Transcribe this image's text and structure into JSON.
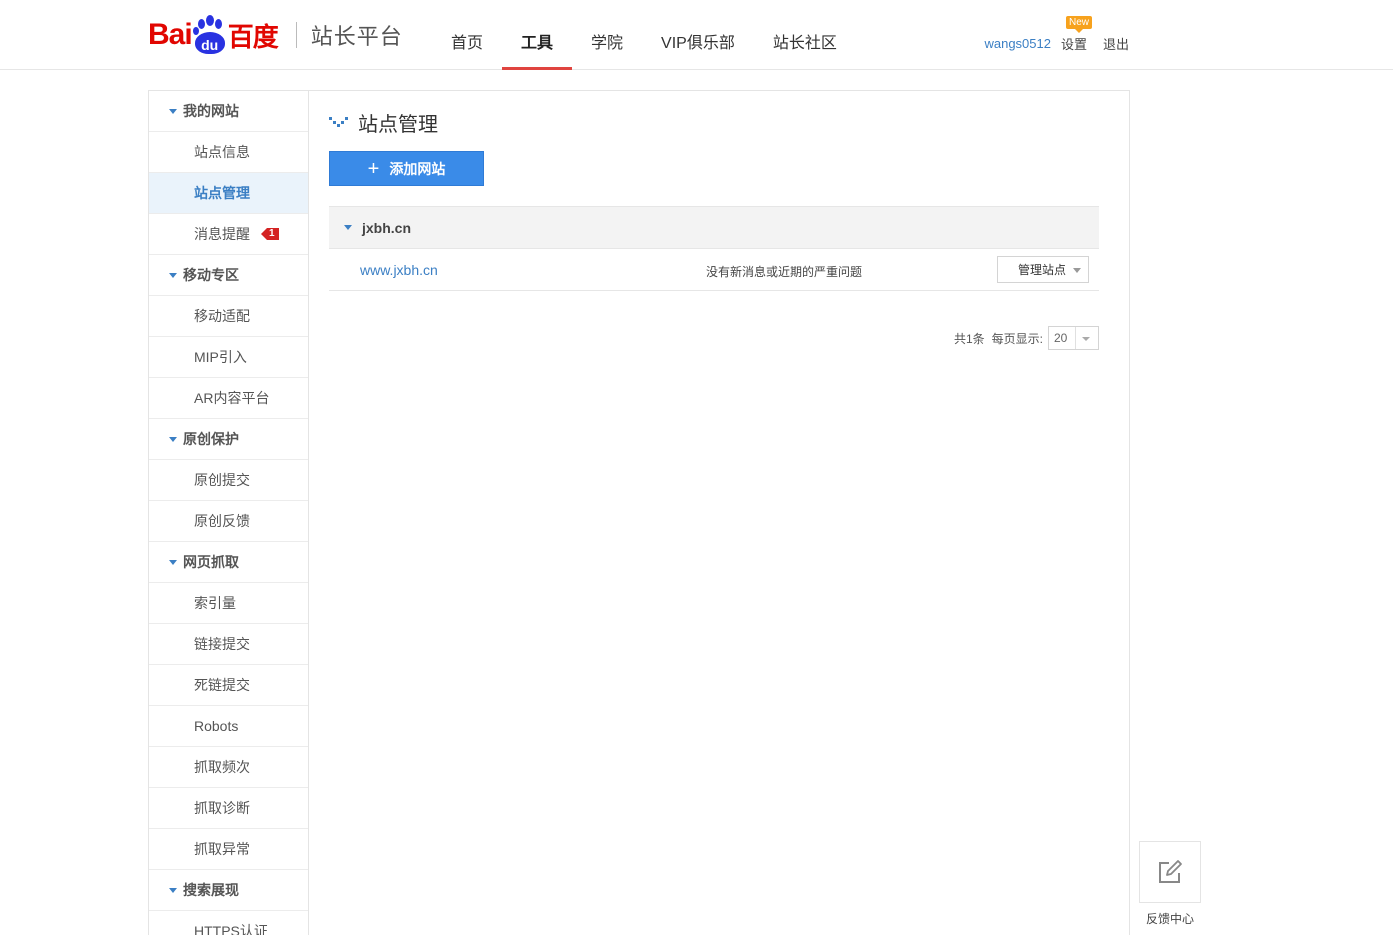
{
  "header": {
    "logo": {
      "bai": "Bai",
      "du": "du",
      "cn": "百度",
      "subtitle": "站长平台"
    },
    "nav": [
      {
        "label": "首页",
        "active": false
      },
      {
        "label": "工具",
        "active": true
      },
      {
        "label": "学院",
        "active": false
      },
      {
        "label": "VIP俱乐部",
        "active": false
      },
      {
        "label": "站长社区",
        "active": false
      }
    ],
    "user": {
      "username": "wangs0512",
      "settings": "设置",
      "new_badge": "New",
      "logout": "退出"
    }
  },
  "sidebar": {
    "groups": [
      {
        "label": "我的网站",
        "items": [
          "站点信息",
          "站点管理",
          "消息提醒"
        ]
      },
      {
        "label": "移动专区",
        "items": [
          "移动适配",
          "MIP引入",
          "AR内容平台"
        ]
      },
      {
        "label": "原创保护",
        "items": [
          "原创提交",
          "原创反馈"
        ]
      },
      {
        "label": "网页抓取",
        "items": [
          "索引量",
          "链接提交",
          "死链提交",
          "Robots",
          "抓取频次",
          "抓取诊断",
          "抓取异常"
        ]
      },
      {
        "label": "搜索展现",
        "items": [
          "HTTPS认证"
        ]
      }
    ],
    "active_item": "站点管理",
    "message_count": "1"
  },
  "main": {
    "title": "站点管理",
    "add_button": "添加网站",
    "site_group": {
      "domain": "jxbh.cn",
      "sites": [
        {
          "url": "www.jxbh.cn",
          "status": "没有新消息或近期的严重问题",
          "action": "管理站点"
        }
      ]
    },
    "pager": {
      "total": "共1条",
      "per_page_label": "每页显示:",
      "per_page_value": "20"
    }
  },
  "feedback": {
    "label": "反馈中心"
  },
  "colors": {
    "accent": "#3a8be8",
    "link": "#3b7fc4",
    "nav_active": "#e0443f",
    "logo_red": "#e10601",
    "logo_blue": "#2932e1",
    "badge": "#d42323"
  }
}
